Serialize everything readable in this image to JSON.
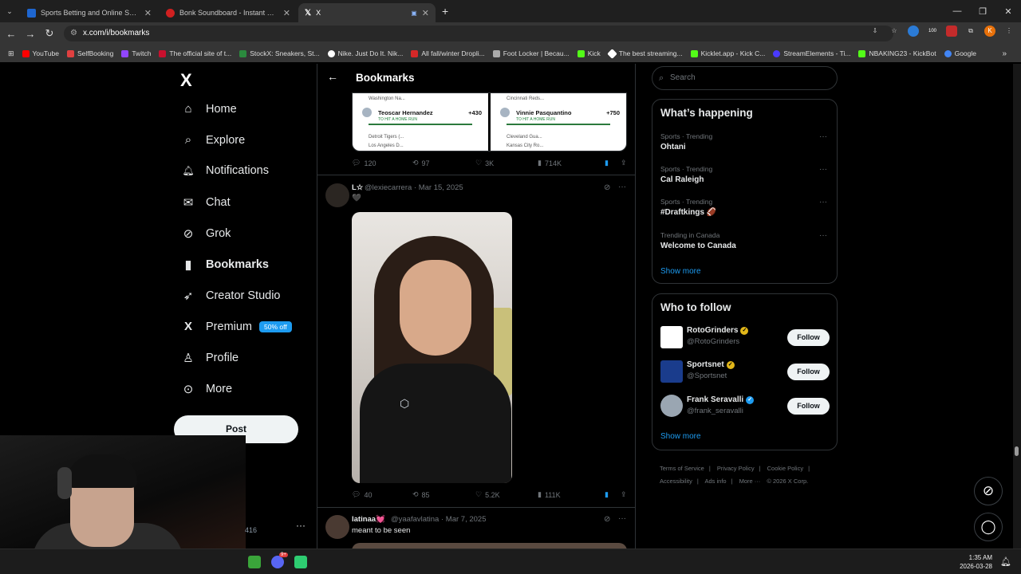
{
  "browser": {
    "tabs": [
      {
        "title": "Sports Betting and Online Spor",
        "active": false,
        "favicon_color": "#1e66d0"
      },
      {
        "title": "Bonk Soundboard - Instant Sou",
        "active": false,
        "favicon_color": "#d02020"
      },
      {
        "title": "X",
        "active": true,
        "favicon_color": "#ffffff"
      }
    ],
    "new_tab": "+",
    "url": "x.com/i/bookmarks",
    "bookmarks": [
      {
        "label": "YouTube",
        "color": "#ff0000"
      },
      {
        "label": "SelfBooking",
        "color": "#e04040"
      },
      {
        "label": "Twitch",
        "color": "#9146ff"
      },
      {
        "label": "The official site of t...",
        "color": "#c8102e"
      },
      {
        "label": "StockX: Sneakers, St...",
        "color": "#2b8a3e"
      },
      {
        "label": "Nike. Just Do It. Nik...",
        "color": "#ffffff"
      },
      {
        "label": "All fall/winter Dropli...",
        "color": "#d62828"
      },
      {
        "label": "Foot Locker | Becau...",
        "color": "#aaaaaa"
      },
      {
        "label": "Kick",
        "color": "#53fc18"
      },
      {
        "label": "The best streaming...",
        "color": "#ffffff"
      },
      {
        "label": "Kicklet.app - Kick C...",
        "color": "#53fc18"
      },
      {
        "label": "StreamElements - Ti...",
        "color": "#4a3aff"
      },
      {
        "label": "NBAKING23 - KickBot",
        "color": "#53fc18"
      },
      {
        "label": "Google",
        "color": "#4285f4"
      }
    ],
    "ext_counter": "100",
    "profile_initial": "K"
  },
  "left_nav": {
    "logo": "X",
    "items": [
      {
        "label": "Home",
        "icon": "home-icon",
        "glyph": "⌂",
        "bold": false
      },
      {
        "label": "Explore",
        "icon": "search-icon",
        "glyph": "⌕",
        "bold": false
      },
      {
        "label": "Notifications",
        "icon": "bell-icon",
        "glyph": "🔔",
        "bold": false
      },
      {
        "label": "Chat",
        "icon": "mail-icon",
        "glyph": "✉",
        "bold": false
      },
      {
        "label": "Grok",
        "icon": "grok-icon",
        "glyph": "⊘",
        "bold": false
      },
      {
        "label": "Bookmarks",
        "icon": "bookmark-icon",
        "glyph": "▮",
        "bold": true
      },
      {
        "label": "Creator Studio",
        "icon": "rocket-icon",
        "glyph": "➶",
        "bold": false
      },
      {
        "label": "Premium",
        "icon": "x-premium-icon",
        "glyph": "X",
        "bold": false
      },
      {
        "label": "Profile",
        "icon": "person-icon",
        "glyph": "♙",
        "bold": false
      },
      {
        "label": "More",
        "icon": "more-circle-icon",
        "glyph": "⋯",
        "bold": false
      }
    ],
    "premium_badge": "50% off",
    "post_button": "Post",
    "account_partial": "416",
    "account_more": "···"
  },
  "feed": {
    "title": "Bookmarks",
    "bet_card": {
      "left": {
        "row1": "Washington Na...",
        "name": "Teoscar Hernandez",
        "sub": "TO HIT A HOME RUN",
        "odds": "+430",
        "row2": "Detroit Tigers (...",
        "row3": "Los Angeles D..."
      },
      "right": {
        "row1": "Cincinnati Reds...",
        "name": "Vinnie Pasquantino",
        "sub": "TO HIT A HOME RUN",
        "odds": "+750",
        "row2": "Cleveland Gua...",
        "row3": "Kansas City Ro..."
      }
    },
    "tweet1_actions": {
      "replies": "120",
      "reposts": "97",
      "likes": "3K",
      "views": "714K"
    },
    "tweet2": {
      "name": "L☆",
      "meta": "@lexiecarrera · Mar 15, 2025",
      "text": "🖤",
      "actions": {
        "replies": "40",
        "reposts": "85",
        "likes": "5.2K",
        "views": "111K"
      }
    },
    "tweet3": {
      "name": "latinaa💓",
      "meta": "@yaafavlatina · Mar 7, 2025",
      "text": "meant to be seen"
    }
  },
  "right_col": {
    "search_placeholder": "Search",
    "whats_happening": {
      "title": "What’s happening",
      "trends": [
        {
          "category": "Sports · Trending",
          "name": "Ohtani"
        },
        {
          "category": "Sports · Trending",
          "name": "Cal Raleigh"
        },
        {
          "category": "Sports · Trending",
          "name": "#Draftkings 🏈"
        },
        {
          "category": "Trending in Canada",
          "name": "Welcome to Canada"
        }
      ],
      "show_more": "Show more"
    },
    "who_to_follow": {
      "title": "Who to follow",
      "accounts": [
        {
          "name": "RotoGrinders",
          "handle": "@RotoGrinders",
          "verified_color": "#e2b719",
          "avatar_color": "#ffffff"
        },
        {
          "name": "Sportsnet",
          "handle": "@Sportsnet",
          "verified_color": "#e2b719",
          "avatar_color": "#1a3c8c"
        },
        {
          "name": "Frank Seravalli",
          "handle": "@frank_seravalli",
          "verified_color": "#1d9bf0",
          "avatar_color": "#9aa6b2"
        }
      ],
      "follow_label": "Follow",
      "show_more": "Show more"
    },
    "footer": [
      "Terms of Service",
      "|",
      "Privacy Policy",
      "|",
      "Cookie Policy",
      "|",
      "Accessibility",
      "|",
      "Ads info",
      "|",
      "More ···",
      "© 2026 X Corp."
    ]
  },
  "taskbar": {
    "time": "1:35 AM",
    "date": "2026-03-28",
    "discord_badge": "9+"
  },
  "colors": {
    "accent": "#1d9bf0",
    "border": "#2f3336",
    "muted": "#71767b"
  }
}
